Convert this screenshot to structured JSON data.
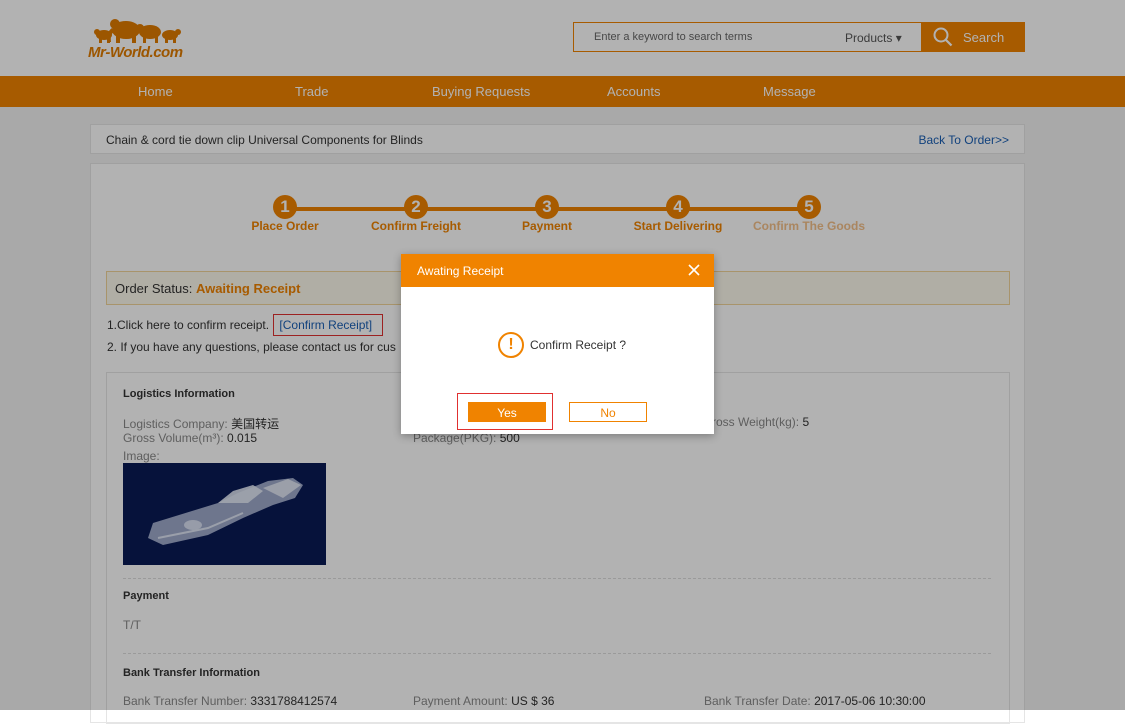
{
  "header": {
    "logo_text": "Mr-World.com",
    "search_placeholder": "Enter a keyword to search terms",
    "search_category": "Products",
    "search_button": "Search"
  },
  "nav": [
    "Home",
    "Trade",
    "Buying Requests",
    "Accounts",
    "Message"
  ],
  "breadcrumb": {
    "title": "Chain & cord tie down clip Universal Components for Blinds",
    "back_link": "Back To Order>>"
  },
  "steps": [
    "Place Order",
    "Confirm Freight",
    "Payment",
    "Start Delivering",
    "Confirm The Goods"
  ],
  "step_numbers": [
    "1",
    "2",
    "3",
    "4",
    "5"
  ],
  "order_status": {
    "label": "Order Status:",
    "value": "Awaiting Receipt"
  },
  "instructions": {
    "line1_text": "1.Click here to confirm receipt.",
    "confirm_link": "[Confirm Receipt]",
    "line2_text": "2. If you have any questions, please contact us for cus"
  },
  "logistics": {
    "heading": "Logistics Information",
    "company_label": "Logistics Company:",
    "company_value": "美国转运",
    "volume_label": "Gross Volume(m³):",
    "volume_value": "0.015",
    "image_label": "Image:",
    "package_label": "Package(PKG):",
    "package_value": "500",
    "weight_label": "ross Weight(kg):",
    "weight_value": "5"
  },
  "payment": {
    "heading": "Payment",
    "method": "T/T"
  },
  "bank": {
    "heading": "Bank Transfer Information",
    "number_label": "Bank Transfer Number:",
    "number_value": "3331788412574",
    "amount_label": "Payment Amount:",
    "amount_value": "US $ 36",
    "date_label": "Bank Transfer Date:",
    "date_value": "2017-05-06 10:30:00"
  },
  "modal": {
    "title": "Awating Receipt",
    "message": "Confirm Receipt ?",
    "yes": "Yes",
    "no": "No"
  },
  "colors": {
    "accent": "#f08300",
    "link": "#1a5fb4",
    "highlight_border": "#e03030"
  }
}
